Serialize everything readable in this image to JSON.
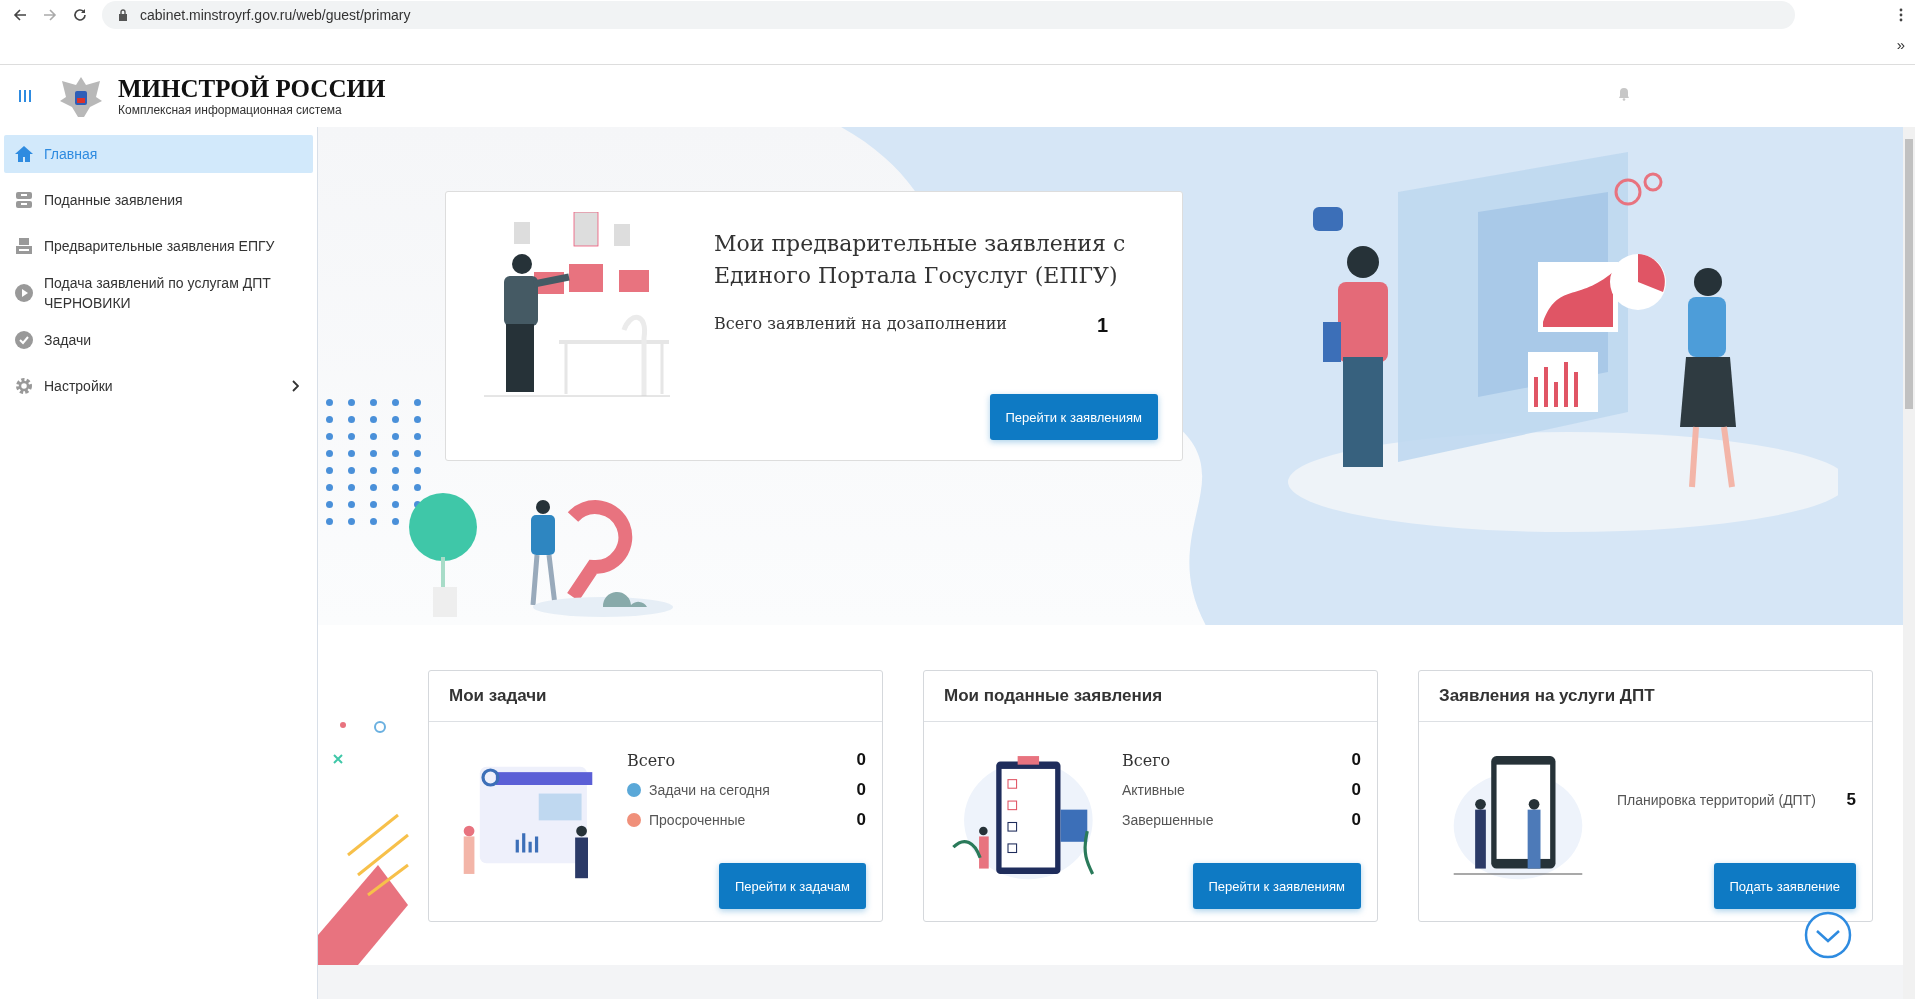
{
  "browser": {
    "url": "cabinet.minstroyrf.gov.ru/web/guest/primary",
    "overflow": "»"
  },
  "header": {
    "title": "МИНСТРОЙ РОССИИ",
    "subtitle": "Комплексная информационная система"
  },
  "sidebar": {
    "items": [
      {
        "label": "Главная",
        "selected": true,
        "submenu": false
      },
      {
        "label": "Поданные заявления",
        "selected": false,
        "submenu": false
      },
      {
        "label": "Предварительные заявления ЕПГУ",
        "selected": false,
        "submenu": false
      },
      {
        "label": "Подача заявлений по услугам ДПТ ЧЕРНОВИКИ",
        "selected": false,
        "submenu": false
      },
      {
        "label": "Задачи",
        "selected": false,
        "submenu": false
      },
      {
        "label": "Настройки",
        "selected": false,
        "submenu": true
      }
    ]
  },
  "hero": {
    "title": "Мои предварительные заявления с Единого Портала Госуслуг (ЕПГУ)",
    "stat_label": "Всего заявлений на дозаполнении",
    "stat_value": "1",
    "button": "Перейти к заявлениям"
  },
  "cards": [
    {
      "title": "Мои задачи",
      "stats": [
        {
          "kind": "total",
          "label": "Всего",
          "value": "0"
        },
        {
          "kind": "dot",
          "label": "Задачи на сегодня",
          "value": "0",
          "color": "#5aa8d8"
        },
        {
          "kind": "dot",
          "label": "Просроченные",
          "value": "0",
          "color": "#f0907a"
        }
      ],
      "button": "Перейти к задачам"
    },
    {
      "title": "Мои поданные заявления",
      "stats": [
        {
          "kind": "total",
          "label": "Всего",
          "value": "0"
        },
        {
          "kind": "plain",
          "label": "Активные",
          "value": "0"
        },
        {
          "kind": "plain",
          "label": "Завершенные",
          "value": "0"
        }
      ],
      "button": "Перейти к заявлениям"
    },
    {
      "title": "Заявления на услуги ДПТ",
      "stats": [
        {
          "kind": "plain",
          "label": "Планировка территорий (ДПТ)",
          "value": "5"
        }
      ],
      "button": "Подать заявление"
    }
  ]
}
